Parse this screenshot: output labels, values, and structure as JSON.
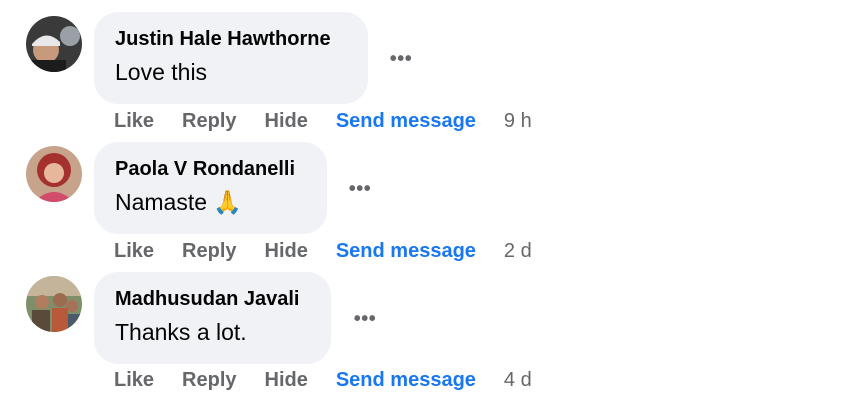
{
  "comments": [
    {
      "author": "Justin Hale Hawthorne",
      "text": "Love this",
      "actions": {
        "like": "Like",
        "reply": "Reply",
        "hide": "Hide",
        "send": "Send message"
      },
      "time": "9 h",
      "more": "•••",
      "avatar_icon": "profile-photo-man-with-cap"
    },
    {
      "author": "Paola V Rondanelli",
      "text": "Namaste 🙏",
      "actions": {
        "like": "Like",
        "reply": "Reply",
        "hide": "Hide",
        "send": "Send message"
      },
      "time": "2 d",
      "more": "•••",
      "avatar_icon": "profile-photo-woman-red-hair"
    },
    {
      "author": "Madhusudan Javali",
      "text": "Thanks a lot.",
      "actions": {
        "like": "Like",
        "reply": "Reply",
        "hide": "Hide",
        "send": "Send message"
      },
      "time": "4 d",
      "more": "•••",
      "avatar_icon": "profile-photo-group-outdoors"
    }
  ],
  "colors": {
    "bubble": "#f0f2f5",
    "text": "#050505",
    "secondary": "#65676b",
    "link": "#1877f2"
  }
}
